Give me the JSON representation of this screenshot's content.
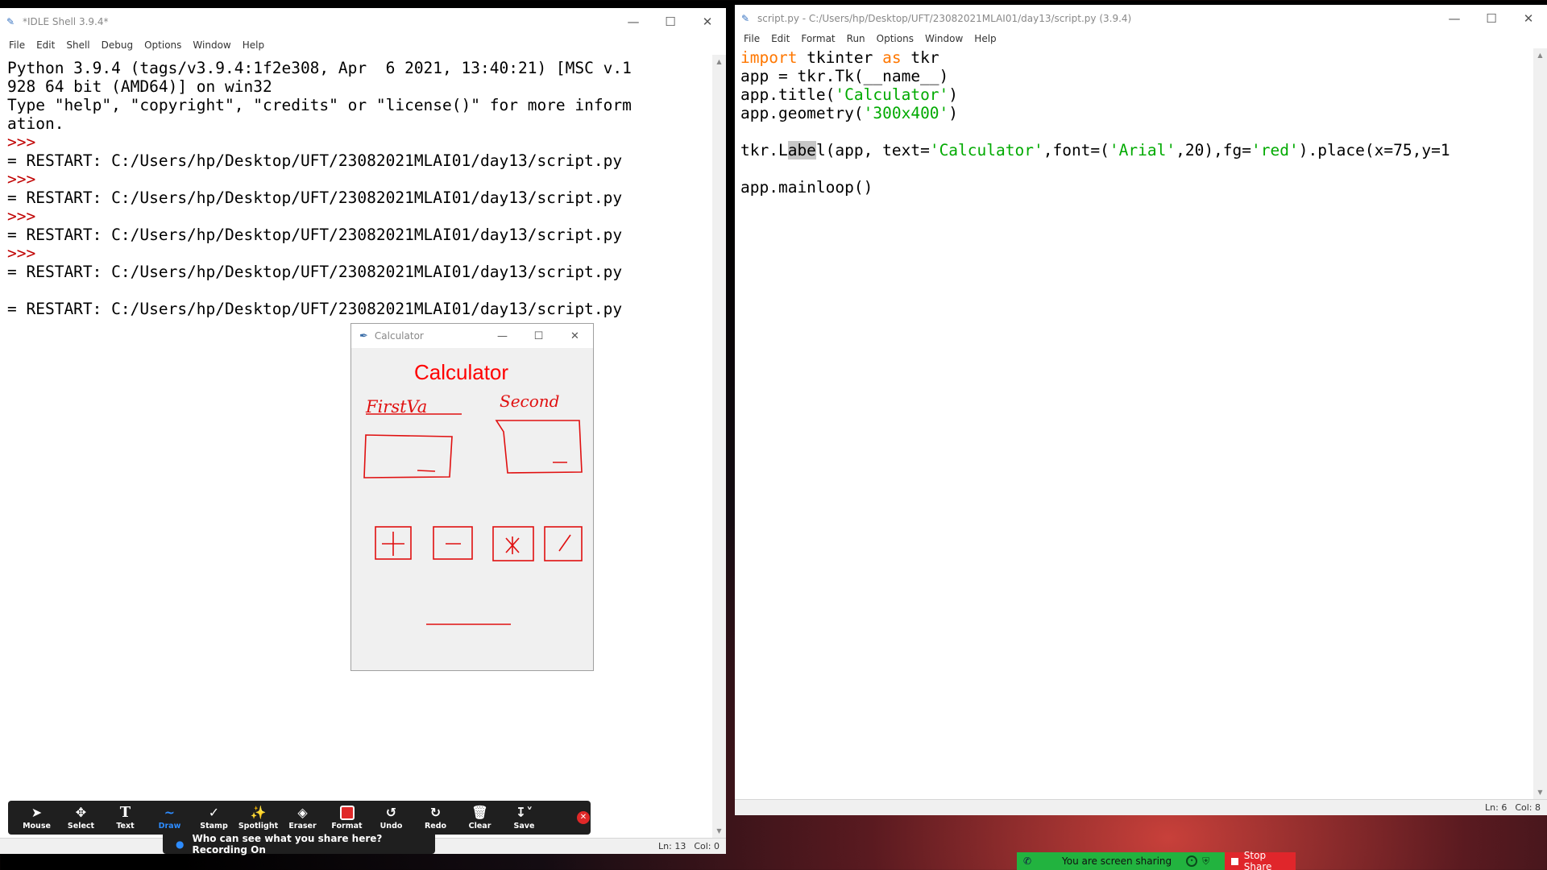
{
  "idle_shell": {
    "title": "*IDLE Shell 3.9.4*",
    "menu": [
      "File",
      "Edit",
      "Shell",
      "Debug",
      "Options",
      "Window",
      "Help"
    ],
    "lines": [
      {
        "type": "text",
        "text": "Python 3.9.4 (tags/v3.9.4:1f2e308, Apr  6 2021, 13:40:21) [MSC v.1"
      },
      {
        "type": "text",
        "text": "928 64 bit (AMD64)] on win32"
      },
      {
        "type": "text",
        "text": "Type \"help\", \"copyright\", \"credits\" or \"license()\" for more inform"
      },
      {
        "type": "text",
        "text": "ation."
      },
      {
        "type": "prompt",
        "text": ">>>"
      },
      {
        "type": "text",
        "text": "= RESTART: C:/Users/hp/Desktop/UFT/23082021MLAI01/day13/script.py"
      },
      {
        "type": "prompt",
        "text": ">>>"
      },
      {
        "type": "text",
        "text": "= RESTART: C:/Users/hp/Desktop/UFT/23082021MLAI01/day13/script.py"
      },
      {
        "type": "prompt",
        "text": ">>>"
      },
      {
        "type": "text",
        "text": "= RESTART: C:/Users/hp/Desktop/UFT/23082021MLAI01/day13/script.py"
      },
      {
        "type": "prompt",
        "text": ">>>"
      },
      {
        "type": "text",
        "text": "= RESTART: C:/Users/hp/Desktop/UFT/23082021MLAI01/day13/script.py"
      },
      {
        "type": "blank",
        "text": ""
      },
      {
        "type": "text",
        "text": "= RESTART: C:/Users/hp/Desktop/UFT/23082021MLAI01/day13/script.py"
      }
    ],
    "status": {
      "ln": "Ln: 13",
      "col": "Col: 0"
    }
  },
  "editor": {
    "title": "script.py - C:/Users/hp/Desktop/UFT/23082021MLAI01/day13/script.py (3.9.4)",
    "menu": [
      "File",
      "Edit",
      "Format",
      "Run",
      "Options",
      "Window",
      "Help"
    ],
    "lines": [
      [
        {
          "t": "import",
          "c": "kw"
        },
        {
          "t": " tkinter ",
          "c": ""
        },
        {
          "t": "as",
          "c": "kw"
        },
        {
          "t": " tkr",
          "c": ""
        }
      ],
      [
        {
          "t": "app = tkr.Tk(__name__)",
          "c": ""
        }
      ],
      [
        {
          "t": "app.title(",
          "c": ""
        },
        {
          "t": "'Calculator'",
          "c": "str"
        },
        {
          "t": ")",
          "c": ""
        }
      ],
      [
        {
          "t": "app.geometry(",
          "c": ""
        },
        {
          "t": "'300x400'",
          "c": "str"
        },
        {
          "t": ")",
          "c": ""
        }
      ],
      [],
      [
        {
          "t": "tkr.L",
          "c": ""
        },
        {
          "t": "abe",
          "c": "sel"
        },
        {
          "t": "l(app, text=",
          "c": ""
        },
        {
          "t": "'Calculator'",
          "c": "str"
        },
        {
          "t": ",font=(",
          "c": ""
        },
        {
          "t": "'Arial'",
          "c": "str"
        },
        {
          "t": ",20),fg=",
          "c": ""
        },
        {
          "t": "'red'",
          "c": "str"
        },
        {
          "t": ").place(x=75,y=1",
          "c": ""
        }
      ],
      [],
      [
        {
          "t": "app.mainloop()",
          "c": ""
        }
      ]
    ],
    "status": {
      "ln": "Ln: 6",
      "col": "Col: 8"
    }
  },
  "calculator": {
    "title": "Calculator",
    "label": "Calculator",
    "label_color": "#ff0000",
    "sketch": {
      "first_label": "FirstVa",
      "second_label": "Second"
    }
  },
  "zoom_toolbar": {
    "tools": [
      {
        "name": "mouse",
        "label": "Mouse",
        "icon": "cursor-icon"
      },
      {
        "name": "select",
        "label": "Select",
        "icon": "move-icon"
      },
      {
        "name": "text",
        "label": "Text",
        "icon": "text-icon"
      },
      {
        "name": "draw",
        "label": "Draw",
        "icon": "squiggle-icon",
        "active": true
      },
      {
        "name": "stamp",
        "label": "Stamp",
        "icon": "check-icon"
      },
      {
        "name": "spotlight",
        "label": "Spotlight",
        "icon": "wand-icon"
      },
      {
        "name": "eraser",
        "label": "Eraser",
        "icon": "eraser-icon"
      },
      {
        "name": "format",
        "label": "Format",
        "icon": "color-swatch-icon"
      },
      {
        "name": "undo",
        "label": "Undo",
        "icon": "undo-icon"
      },
      {
        "name": "redo",
        "label": "Redo",
        "icon": "redo-icon"
      },
      {
        "name": "clear",
        "label": "Clear",
        "icon": "trash-icon"
      },
      {
        "name": "save",
        "label": "Save",
        "icon": "save-icon"
      }
    ],
    "active_color": "#2d8cff",
    "who_can_see": "Who can see what you share here? Recording On"
  },
  "share_bar": {
    "status": "You are screen sharing",
    "stop": "Stop Share",
    "color": "#22b33f",
    "stop_color": "#e0262b"
  }
}
